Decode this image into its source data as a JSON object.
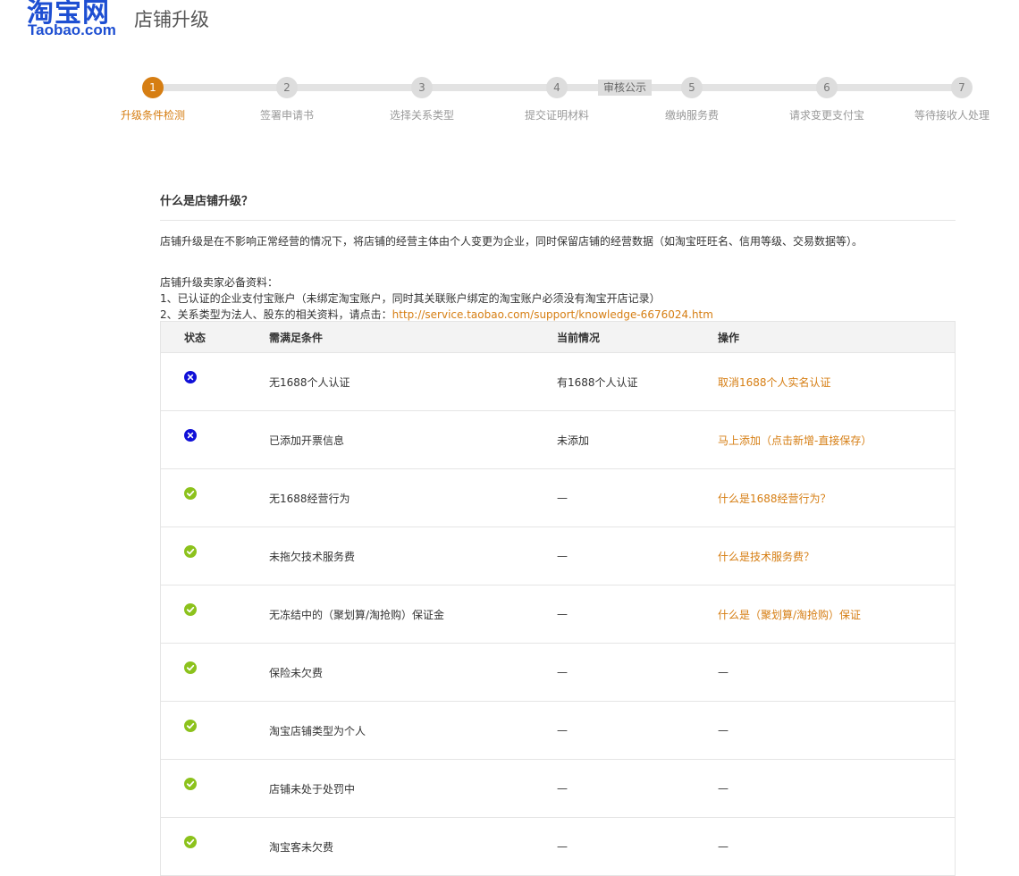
{
  "logo": {
    "cn": "淘宝网",
    "en": "Taobao.com"
  },
  "page_title": "店铺升级",
  "steps": [
    {
      "num": "1",
      "label": "升级条件检测"
    },
    {
      "num": "2",
      "label": "签署申请书"
    },
    {
      "num": "3",
      "label": "选择关系类型"
    },
    {
      "num": "4",
      "label": "提交证明材料"
    },
    {
      "num": "5",
      "label": "缴纳服务费"
    },
    {
      "num": "6",
      "label": "请求变更支付宝"
    },
    {
      "num": "7",
      "label": "等待接收人处理"
    }
  ],
  "review_tag": "审核公示",
  "section": {
    "title": "什么是店铺升级？",
    "intro": "店铺升级是在不影响正常经营的情况下，将店铺的经营主体由个人变更为企业，同时保留店铺的经营数据（如淘宝旺旺名、信用等级、交易数据等）。",
    "req_title": "店铺升级卖家必备资料：",
    "req_1": "1、已认证的企业支付宝账户（未绑定淘宝账户，同时其关联账户绑定的淘宝账户必须没有淘宝开店记录）",
    "req_2_prefix": "2、关系类型为法人、股东的相关资料，请点击：",
    "req_2_link": "http://service.taobao.com/support/knowledge-6676024.htm"
  },
  "table": {
    "headers": {
      "status": "状态",
      "condition": "需满足条件",
      "current": "当前情况",
      "action": "操作"
    },
    "rows": [
      {
        "status": "fail",
        "condition": "无1688个人认证",
        "current": "有1688个人认证",
        "action": "取消1688个人实名认证"
      },
      {
        "status": "fail",
        "condition": "已添加开票信息",
        "current": "未添加",
        "action": "马上添加（点击新增-直接保存）"
      },
      {
        "status": "ok",
        "condition": "无1688经营行为",
        "current": "—",
        "action": "什么是1688经营行为？"
      },
      {
        "status": "ok",
        "condition": "未拖欠技术服务费",
        "current": "—",
        "action": "什么是技术服务费？"
      },
      {
        "status": "ok",
        "condition": "无冻结中的（聚划算/淘抢购）保证金",
        "current": "—",
        "action": "什么是（聚划算/淘抢购）保证"
      },
      {
        "status": "ok",
        "condition": "保险未欠费",
        "current": "—",
        "action": "—"
      },
      {
        "status": "ok",
        "condition": "淘宝店铺类型为个人",
        "current": "—",
        "action": "—"
      },
      {
        "status": "ok",
        "condition": "店铺未处于处罚中",
        "current": "—",
        "action": "—"
      },
      {
        "status": "ok",
        "condition": "淘宝客未欠费",
        "current": "—",
        "action": "—"
      }
    ]
  },
  "colors": {
    "brand": "#1e4fd2",
    "accent": "#d67e13",
    "fail": "#1010d8",
    "ok": "#8cc21c"
  }
}
